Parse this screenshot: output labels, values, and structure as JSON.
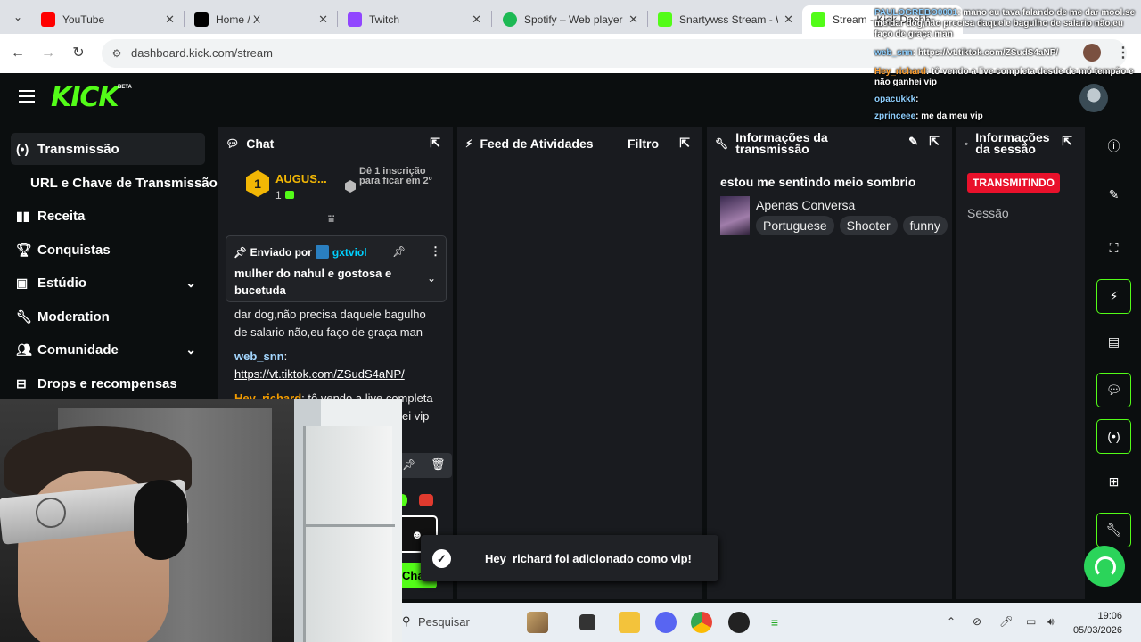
{
  "browser": {
    "tabs": [
      {
        "title": "YouTube",
        "color": "#ff0000"
      },
      {
        "title": "Home / X",
        "color": "#000000"
      },
      {
        "title": "Twitch",
        "color": "#9146ff"
      },
      {
        "title": "Spotify – Web player",
        "color": "#1db954"
      },
      {
        "title": "Snartywss Stream - W",
        "color": "#53fc18"
      },
      {
        "title": "Stream - Kick Dashb",
        "color": "#53fc18"
      }
    ],
    "url": "dashboard.kick.com/stream"
  },
  "kick": {
    "logo": "KICK",
    "beta": "BETA",
    "accent": "#53fc18"
  },
  "sidebar": {
    "items": [
      {
        "label": "Transmissão",
        "icon": "broadcast-icon"
      },
      {
        "label": "URL e Chave de Transmissão"
      },
      {
        "label": "Receita",
        "icon": "revenue-icon"
      },
      {
        "label": "Conquistas",
        "icon": "trophy-icon"
      },
      {
        "label": "Estúdio",
        "icon": "studio-icon"
      },
      {
        "label": "Moderation",
        "icon": "wrench-icon"
      },
      {
        "label": "Comunidade",
        "icon": "community-icon"
      },
      {
        "label": "Drops e recompensas",
        "icon": "drops-icon"
      }
    ]
  },
  "chat": {
    "title": "Chat",
    "leader": {
      "rank": "1",
      "name": "AUGUS...",
      "count": "1"
    },
    "next_text": "Dê 1 inscrição para ficar em 2º",
    "pinned": {
      "prefix": "Enviado por",
      "user": "gxtviol",
      "message": "mulher do nahul e gostosa e bucetuda"
    },
    "messages": [
      {
        "text": "dar dog,não precisa daquele bagulho de salario não,eu faço de graça man"
      },
      {
        "user": "web_snn",
        "sep": ":",
        "link": "https://vt.tiktok.com/ZSudS4aNP/"
      },
      {
        "user": "Hey_richard",
        "text": ": tô vendo a live completa"
      },
      {
        "text": "ei vip"
      }
    ],
    "send_label": "Cha"
  },
  "feed": {
    "title": "Feed de Atividades",
    "filter": "Filtro"
  },
  "info": {
    "title_line1": "Informações da",
    "title_line2": "transmissão",
    "stream_title": "estou me sentindo meio sombrio",
    "category": "Apenas Conversa",
    "tags": [
      "Portuguese",
      "Shooter",
      "funny"
    ]
  },
  "session": {
    "title_line1": "Informações",
    "title_line2": "da sessão",
    "live": "TRANSMITINDO",
    "label": "Sessão"
  },
  "overlay_chat": [
    {
      "user": "PAULOGREBO0001",
      "text": ": mano eu tava falando de me dar mool.se tu for"
    },
    {
      "text": "me dar dog,não precisa daquele bagulho de salario não,eu"
    },
    {
      "text": "faço de graça man"
    },
    {
      "user": "web_snn",
      "text": ": https://vt.tiktok.com/ZSudS4aNP/"
    },
    {
      "user": "Hey_richard",
      "text": ": tô vendo a live completa desde de mó tempão e",
      "orange": true
    },
    {
      "text": "não ganhei vip"
    },
    {
      "user": "opacukkk",
      "text": ":"
    },
    {
      "user": "zprinceee",
      "text": ": me da meu vip"
    }
  ],
  "toast": {
    "message": "Hey_richard foi adicionado como vip!"
  },
  "taskbar": {
    "search_placeholder": "Pesquisar",
    "time": "19:06",
    "date": "05/03/2026"
  }
}
